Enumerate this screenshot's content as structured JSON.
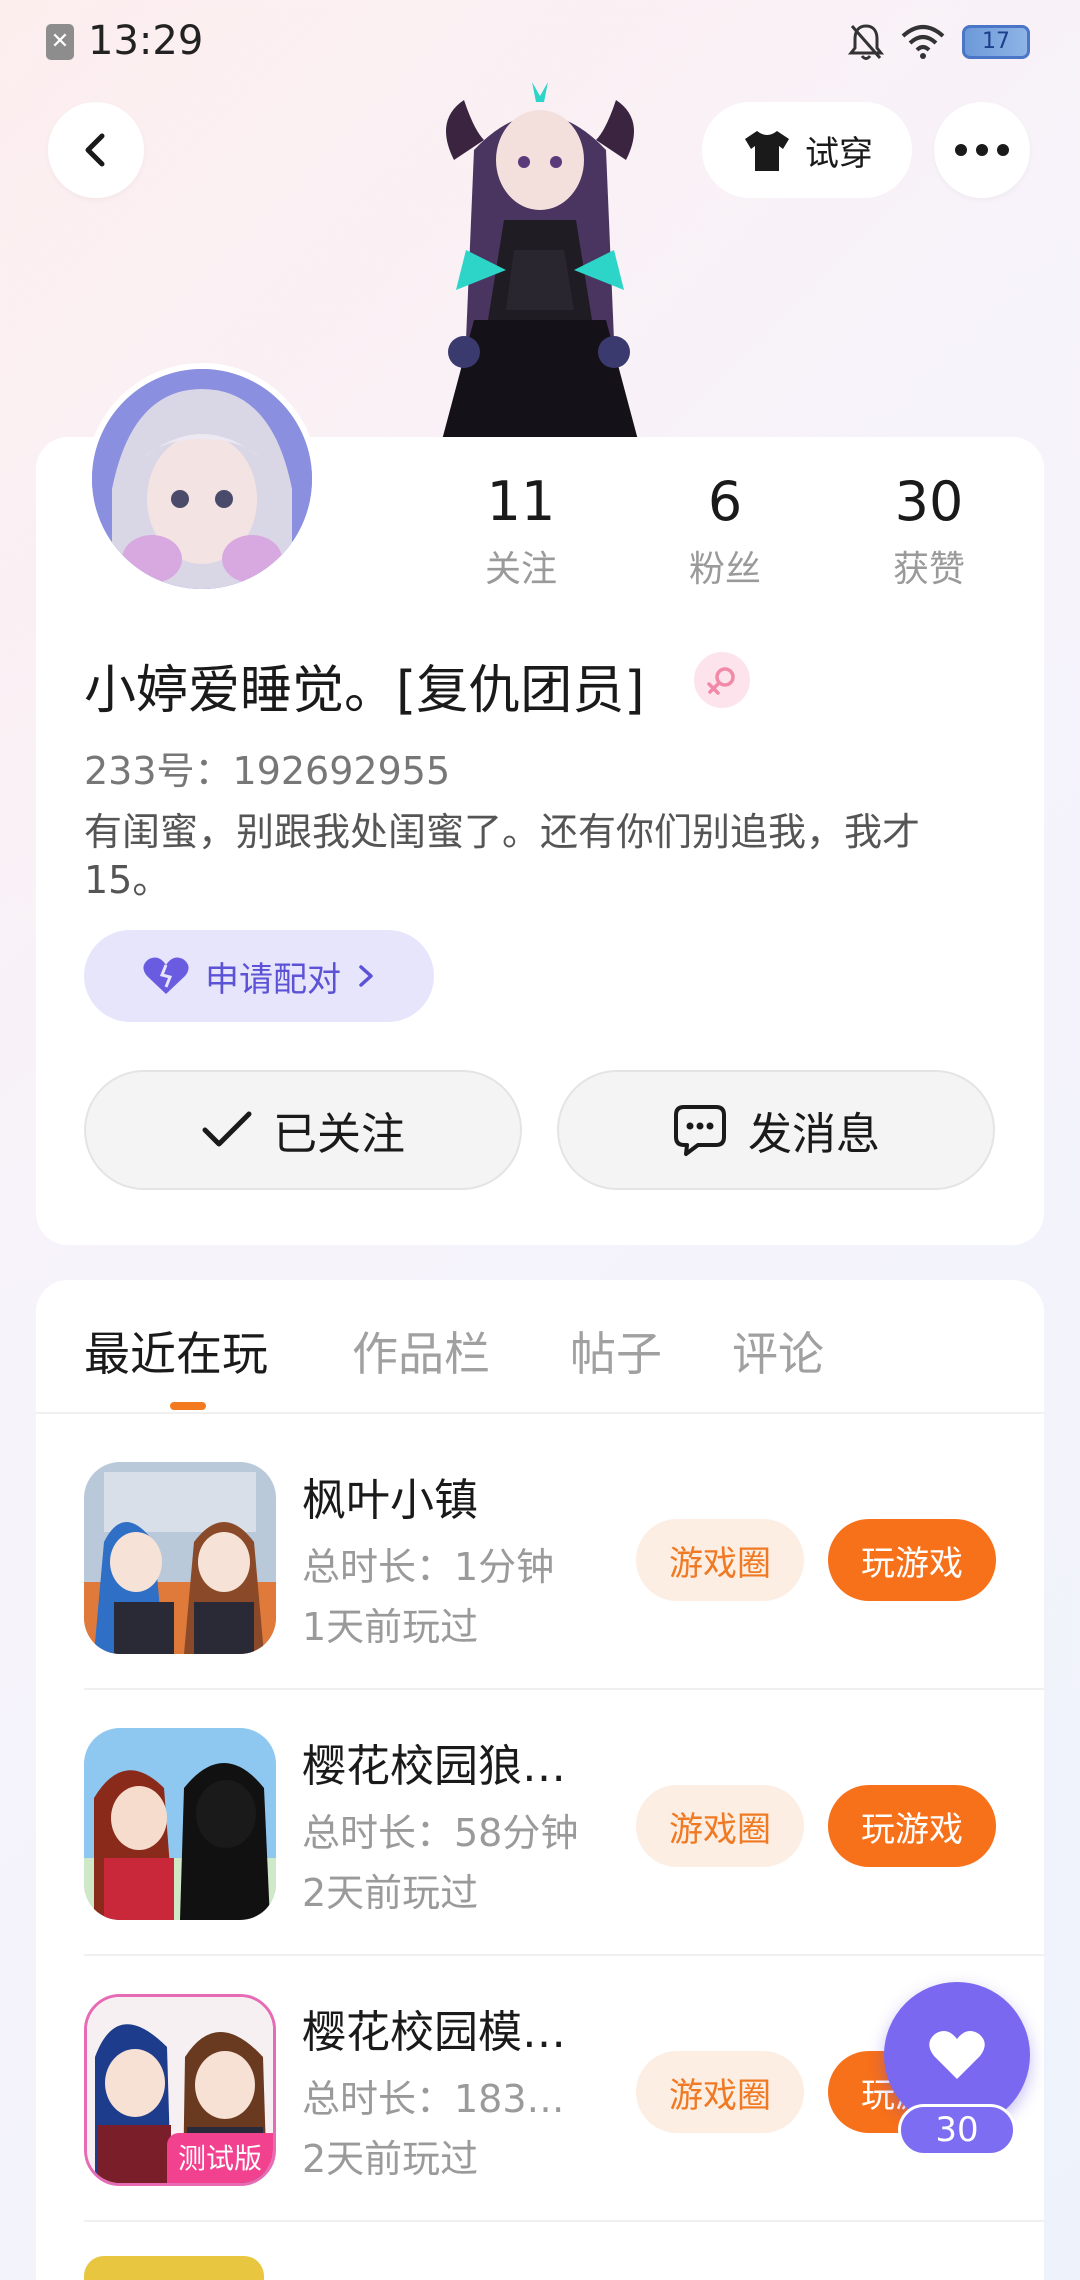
{
  "status_bar": {
    "time": "13:29",
    "battery": "17"
  },
  "header": {
    "try_on_label": "试穿"
  },
  "profile": {
    "stats": [
      {
        "num": "11",
        "label": "关注"
      },
      {
        "num": "6",
        "label": "粉丝"
      },
      {
        "num": "30",
        "label": "获赞"
      }
    ],
    "username": "小婷爱睡觉。[复仇团员]",
    "uid": "233号：192692955",
    "bio": "有闺蜜，别跟我处闺蜜了。还有你们别追我，我才15。",
    "pair_label": "申请配对",
    "followed_label": "已关注",
    "message_label": "发消息"
  },
  "tabs": [
    {
      "label": "最近在玩"
    },
    {
      "label": "作品栏"
    },
    {
      "label": "帖子"
    },
    {
      "label": "评论"
    }
  ],
  "games": [
    {
      "title": "枫叶小镇",
      "duration": "总时长：1分钟",
      "last_played": "1天前玩过",
      "circle_label": "游戏圈",
      "play_label": "玩游戏"
    },
    {
      "title": "樱花校园狼…",
      "duration": "总时长：58分钟",
      "last_played": "2天前玩过",
      "circle_label": "游戏圈",
      "play_label": "玩游戏"
    },
    {
      "title": "樱花校园模…",
      "duration": "总时长：183…",
      "last_played": "2天前玩过",
      "circle_label": "游戏圈",
      "play_label": "玩游戏",
      "icon_badge": "测试版"
    }
  ],
  "like": {
    "count": "30"
  },
  "colors": {
    "accent_orange": "#f7701a",
    "accent_purple": "#7a68f0"
  }
}
